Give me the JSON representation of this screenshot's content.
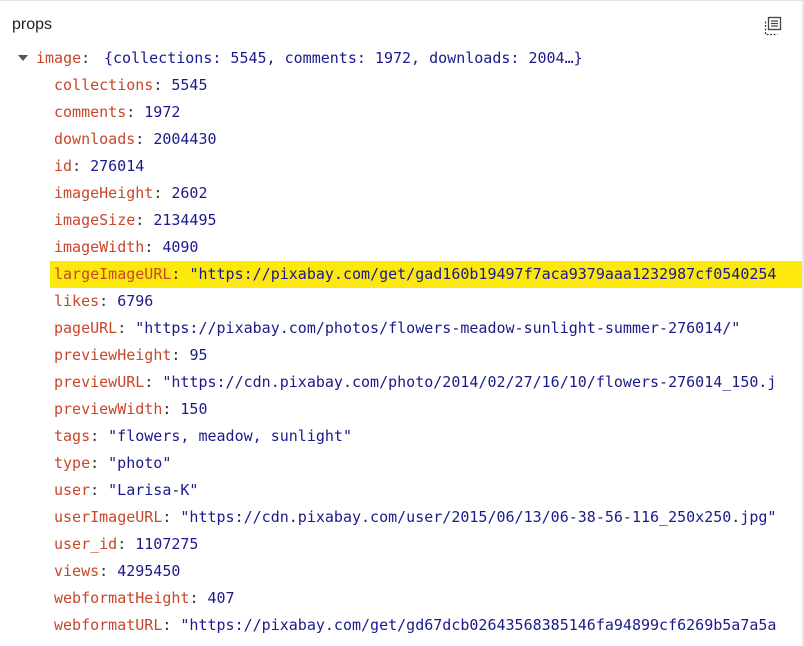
{
  "panel": {
    "title": "props",
    "copy_icon": "copy-icon"
  },
  "root": {
    "key": "image",
    "summary": "{collections: 5545, comments: 1972, downloads: 2004…}",
    "expanded": true
  },
  "properties": [
    {
      "key": "collections",
      "value": "5545",
      "type": "number"
    },
    {
      "key": "comments",
      "value": "1972",
      "type": "number"
    },
    {
      "key": "downloads",
      "value": "2004430",
      "type": "number"
    },
    {
      "key": "id",
      "value": "276014",
      "type": "number"
    },
    {
      "key": "imageHeight",
      "value": "2602",
      "type": "number"
    },
    {
      "key": "imageSize",
      "value": "2134495",
      "type": "number"
    },
    {
      "key": "imageWidth",
      "value": "4090",
      "type": "number"
    },
    {
      "key": "largeImageURL",
      "value": "\"https://pixabay.com/get/gad160b19497f7aca9379aaa1232987cf0540254",
      "type": "string",
      "highlighted": true
    },
    {
      "key": "likes",
      "value": "6796",
      "type": "number"
    },
    {
      "key": "pageURL",
      "value": "\"https://pixabay.com/photos/flowers-meadow-sunlight-summer-276014/\"",
      "type": "string"
    },
    {
      "key": "previewHeight",
      "value": "95",
      "type": "number"
    },
    {
      "key": "previewURL",
      "value": "\"https://cdn.pixabay.com/photo/2014/02/27/16/10/flowers-276014_150.j",
      "type": "string"
    },
    {
      "key": "previewWidth",
      "value": "150",
      "type": "number"
    },
    {
      "key": "tags",
      "value": "\"flowers, meadow, sunlight\"",
      "type": "string"
    },
    {
      "key": "type",
      "value": "\"photo\"",
      "type": "string"
    },
    {
      "key": "user",
      "value": "\"Larisa-K\"",
      "type": "string"
    },
    {
      "key": "userImageURL",
      "value": "\"https://cdn.pixabay.com/user/2015/06/13/06-38-56-116_250x250.jpg\"",
      "type": "string"
    },
    {
      "key": "user_id",
      "value": "1107275",
      "type": "number"
    },
    {
      "key": "views",
      "value": "4295450",
      "type": "number"
    },
    {
      "key": "webformatHeight",
      "value": "407",
      "type": "number"
    },
    {
      "key": "webformatURL",
      "value": "\"https://pixabay.com/get/gd67dcb02643568385146fa94899cf6269b5a7a5a",
      "type": "string"
    }
  ],
  "colors": {
    "key": "#c8462a",
    "value": "#1a1a8c",
    "highlight": "#fce80a"
  }
}
